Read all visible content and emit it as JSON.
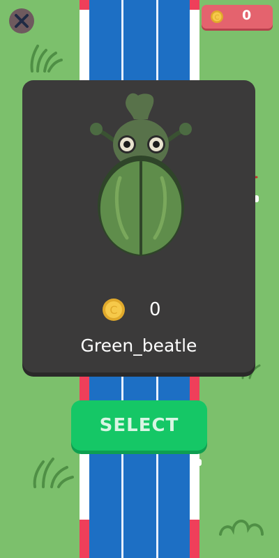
{
  "hud": {
    "coin_count": "0",
    "close_icon": "close-icon",
    "coin_icon": "coin-icon"
  },
  "selector": {
    "price": "0",
    "character_name": "Green_beatle",
    "select_label": "SELECT"
  },
  "colors": {
    "grass": "#7cc06c",
    "road": "#1d6fc4",
    "panel": "#3b3a3a",
    "select_button": "#15c766",
    "counter_bg": "#e4636e"
  }
}
